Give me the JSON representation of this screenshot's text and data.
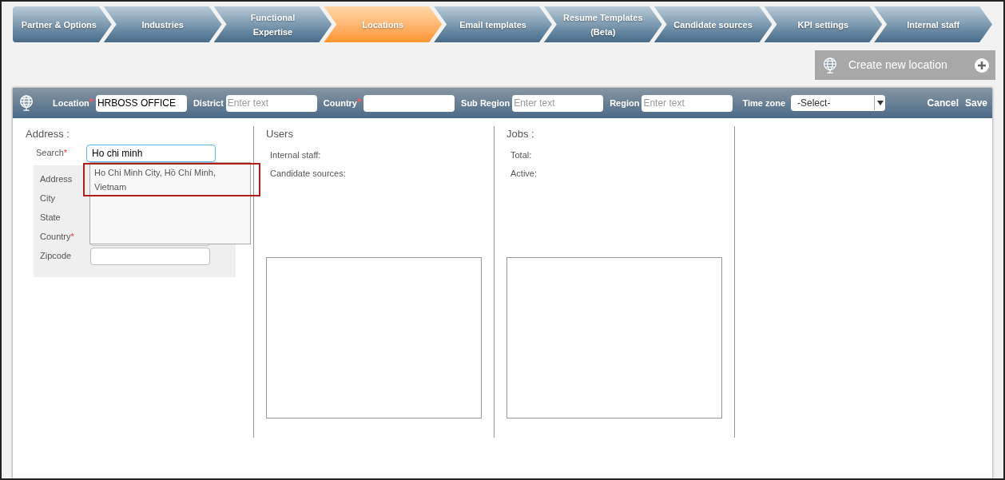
{
  "tabs": [
    {
      "label": "Partner & Options",
      "selected": false
    },
    {
      "label": "Industries",
      "selected": false
    },
    {
      "label": "Functional Expertise",
      "selected": false
    },
    {
      "label": "Locations",
      "selected": true
    },
    {
      "label": "Email templates",
      "selected": false
    },
    {
      "label": "Resume Templates (Beta)",
      "selected": false
    },
    {
      "label": "Candidate sources",
      "selected": false
    },
    {
      "label": "KPI settings",
      "selected": false
    },
    {
      "label": "Internal staff",
      "selected": false
    }
  ],
  "create_button": {
    "label": "Create new location"
  },
  "header": {
    "fields": [
      {
        "kind": "text",
        "label": "Location",
        "required_mark": "*",
        "value": "HRBOSS OFFICE"
      },
      {
        "kind": "text",
        "label": "District",
        "placeholder": "Enter text"
      },
      {
        "kind": "text",
        "label": "Country",
        "required_mark": "*"
      },
      {
        "kind": "text",
        "label": "Sub Region",
        "placeholder": "Enter text"
      },
      {
        "kind": "text",
        "label": "Region",
        "placeholder": "Enter text"
      },
      {
        "kind": "select",
        "label": "Time zone",
        "value": "-Select-"
      }
    ],
    "actions": [
      "Cancel",
      "Save"
    ]
  },
  "address": {
    "title": "Address :",
    "search": {
      "label": "Search",
      "required_mark": "*",
      "value": "Ho chi minh"
    },
    "fields": [
      {
        "label": "Address"
      },
      {
        "label": "City"
      },
      {
        "label": "State"
      },
      {
        "label": "Country",
        "required_mark": "*"
      },
      {
        "label": "Zipcode"
      }
    ],
    "suggestions": [
      {
        "text": "Ho Chi Minh City, Hồ Chí Minh, Vietnam",
        "highlighted": true
      }
    ]
  },
  "users": {
    "title": "Users",
    "lines": [
      "Internal staff:",
      "Candidate sources:"
    ]
  },
  "jobs": {
    "title": "Jobs :",
    "lines": [
      "Total:",
      "Active:"
    ]
  }
}
